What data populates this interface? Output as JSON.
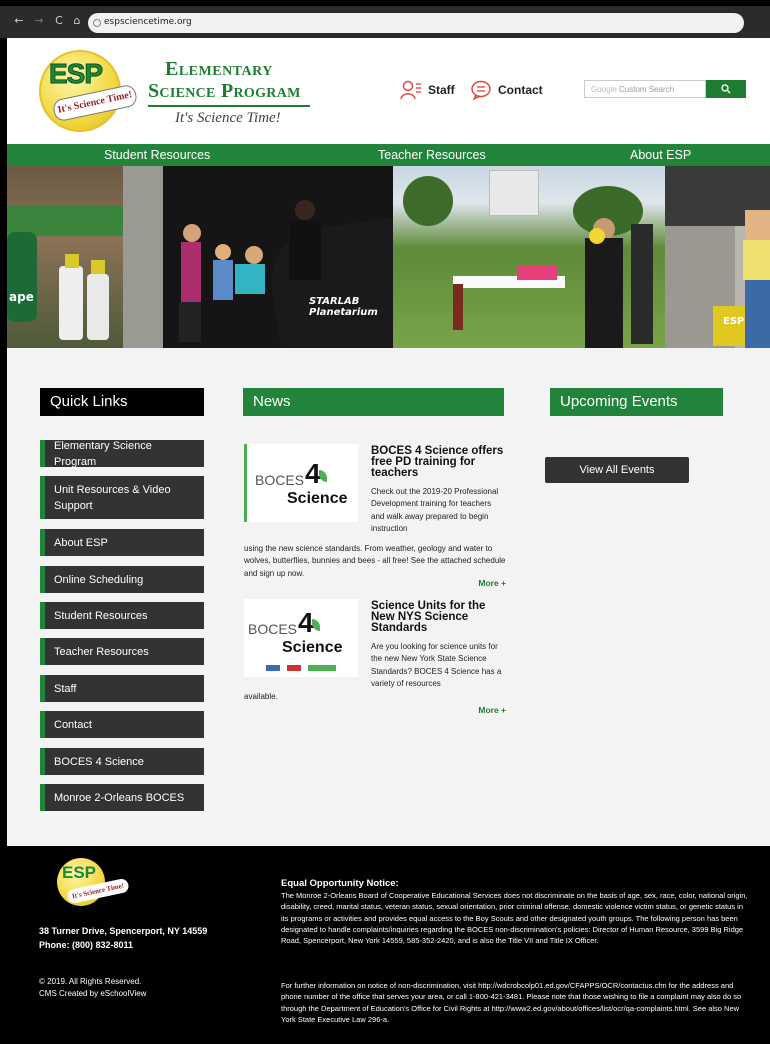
{
  "browser": {
    "url": "espsciencetime.org",
    "nav": [
      "←",
      "→",
      "C",
      "⌂"
    ]
  },
  "header": {
    "logo": {
      "esp": "ESP",
      "tag": "It's Science Time!"
    },
    "brand_line1": "Elementary",
    "brand_line2": "Science Program",
    "tagline": "It's Science Time!",
    "staff_label": "Staff",
    "contact_label": "Contact",
    "search_placeholder": "Custom Search",
    "search_brand": "Google",
    "search_icon": "search-icon"
  },
  "nav": {
    "items": [
      "Student Resources",
      "Teacher Resources",
      "About ESP"
    ]
  },
  "hero": {
    "photo_text": {
      "planetarium": "STARLAB Planetarium",
      "esp_bin": "ESP",
      "ape": "ape"
    }
  },
  "quick_links": {
    "heading": "Quick Links",
    "items": [
      "Elementary Science Program",
      "Unit Resources & Video Support",
      "About ESP",
      "Online Scheduling",
      "Student Resources",
      "Teacher Resources",
      "Staff",
      "Contact",
      "BOCES 4 Science",
      "Monroe 2-Orleans BOCES"
    ]
  },
  "news": {
    "heading": "News",
    "items": [
      {
        "title": "BOCES 4 Science offers free PD training for teachers",
        "body_side": "Check out the 2019-20 Professional Development training for teachers and walk away prepared to begin instruction",
        "body_full": "using the new science standards. From weather, geology and water to wolves, butterflies, bunnies and bees - all free! See the attached schedule and sign up now.",
        "more": "More +",
        "logo_a": "BOCES",
        "logo_num": "4",
        "logo_b": "Science"
      },
      {
        "title": "Science Units for the New NYS Science Standards",
        "body_side": "Are you looking for science units for the new New York State Science Standards? BOCES 4 Science has a variety of resources",
        "body_full": "available.",
        "more": "More +",
        "logo_a": "BOCES",
        "logo_num": "4",
        "logo_b": "Science"
      }
    ]
  },
  "events": {
    "heading": "Upcoming Events",
    "button": "View All Events"
  },
  "footer": {
    "logo": {
      "esp": "ESP",
      "tag": "It's Science Time!"
    },
    "address": "38 Turner Drive, Spencerport, NY 14559",
    "phone": "Phone: (800) 832-8011",
    "copyright": "© 2019. All Rights Reserved.",
    "cms": "CMS Created by eSchoolView",
    "eo_title": "Equal Opportunity Notice:",
    "eo_text": "The Monroe 2-Orleans Board of Cooperative Educational Services does not discriminate on the basis of age, sex, race, color, national origin, disability, creed, marital status, veteran status, sexual orientation, prior criminal offense, domestic violence victim status, or genetic status in its programs or activities and provides equal access to the Boy Scouts and other designated youth groups. The following person has been designated to handle complaints/inquiries regarding the BOCES non-discrimination's policies: Director of Human Resource, 3599 Big Ridge Road, Spencerport, New York 14559, 585-352-2420, and is also the Title VII and Title IX Officer.",
    "eo_text2": "For further information on notice of non-discrimination, visit http://wdcrobcolp01.ed.gov/CFAPPS/OCR/contactus.cfm for the address and phone number of the office that serves your area, or call 1-800-421-3481. Please note that those wishing to file a complaint may also do so through the Department of Education's Office for Civil Rights at http://www2.ed.gov/about/offices/list/ocr/qa-complaints.html. See also New York State Executive Law 296-a."
  },
  "colors": {
    "brand_green": "#22843a",
    "dark_button": "#333333",
    "footer_bg": "#000000"
  }
}
